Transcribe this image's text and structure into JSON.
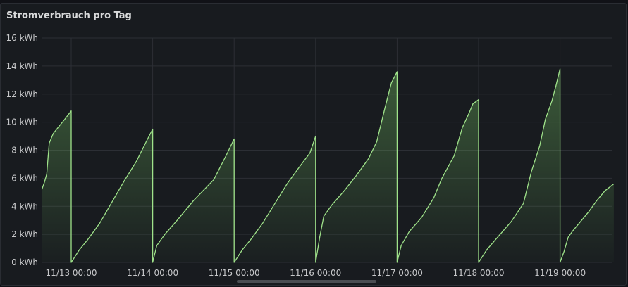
{
  "panel": {
    "title": "Stromverbrauch pro Tag"
  },
  "colors": {
    "line": "#9fe28a",
    "fill_top": "#7ed36a",
    "background": "#181b1f",
    "grid": "#2c2f35",
    "text": "#c7c8ca"
  },
  "chart_data": {
    "type": "area",
    "title": "Stromverbrauch pro Tag",
    "xlabel": "",
    "ylabel": "",
    "unit": "kWh",
    "ylim": [
      0,
      16
    ],
    "y_ticks": [
      "0 kWh",
      "2 kWh",
      "4 kWh",
      "6 kWh",
      "8 kWh",
      "10 kWh",
      "12 kWh",
      "14 kWh",
      "16 kWh"
    ],
    "x_tick_labels": [
      "11/13 00:00",
      "11/14 00:00",
      "11/15 00:00",
      "11/16 00:00",
      "11/17 00:00",
      "11/18 00:00",
      "11/19 00:00"
    ],
    "x_range_days": [
      -0.36,
      6.66
    ],
    "grid": true,
    "legend": "none",
    "series": [
      {
        "values_by_day": [
          [
            [
              -0.36,
              5.2
            ],
            [
              -0.33,
              5.7
            ],
            [
              -0.3,
              6.3
            ],
            [
              -0.27,
              8.5
            ],
            [
              -0.22,
              9.2
            ],
            [
              -0.15,
              9.7
            ],
            [
              -0.08,
              10.2
            ],
            [
              0.0,
              10.8
            ]
          ],
          [
            [
              0.0,
              0.0
            ],
            [
              0.1,
              0.9
            ],
            [
              0.2,
              1.6
            ],
            [
              0.35,
              2.8
            ],
            [
              0.5,
              4.3
            ],
            [
              0.65,
              5.8
            ],
            [
              0.8,
              7.2
            ],
            [
              0.92,
              8.6
            ],
            [
              1.0,
              9.5
            ]
          ],
          [
            [
              1.0,
              0.0
            ],
            [
              1.05,
              1.2
            ],
            [
              1.15,
              2.0
            ],
            [
              1.3,
              3.0
            ],
            [
              1.5,
              4.4
            ],
            [
              1.6,
              5.0
            ],
            [
              1.75,
              5.9
            ],
            [
              1.9,
              7.6
            ],
            [
              2.0,
              8.8
            ]
          ],
          [
            [
              2.0,
              0.0
            ],
            [
              2.1,
              0.9
            ],
            [
              2.2,
              1.6
            ],
            [
              2.35,
              2.8
            ],
            [
              2.5,
              4.2
            ],
            [
              2.65,
              5.6
            ],
            [
              2.8,
              6.8
            ],
            [
              2.93,
              7.8
            ],
            [
              3.0,
              9.0
            ]
          ],
          [
            [
              3.0,
              0.0
            ],
            [
              3.05,
              1.8
            ],
            [
              3.1,
              3.3
            ],
            [
              3.2,
              4.1
            ],
            [
              3.35,
              5.1
            ],
            [
              3.5,
              6.2
            ],
            [
              3.65,
              7.4
            ],
            [
              3.75,
              8.6
            ],
            [
              3.85,
              11.0
            ],
            [
              3.93,
              12.8
            ],
            [
              4.0,
              13.6
            ]
          ],
          [
            [
              4.0,
              0.0
            ],
            [
              4.05,
              1.2
            ],
            [
              4.15,
              2.2
            ],
            [
              4.3,
              3.2
            ],
            [
              4.45,
              4.6
            ],
            [
              4.55,
              6.0
            ],
            [
              4.7,
              7.6
            ],
            [
              4.8,
              9.6
            ],
            [
              4.88,
              10.6
            ],
            [
              4.93,
              11.3
            ],
            [
              5.0,
              11.6
            ]
          ],
          [
            [
              5.0,
              0.0
            ],
            [
              5.1,
              0.9
            ],
            [
              5.25,
              1.9
            ],
            [
              5.4,
              2.9
            ],
            [
              5.55,
              4.2
            ],
            [
              5.65,
              6.5
            ],
            [
              5.75,
              8.3
            ],
            [
              5.82,
              10.2
            ],
            [
              5.9,
              11.5
            ],
            [
              5.95,
              12.6
            ],
            [
              6.0,
              13.8
            ]
          ],
          [
            [
              6.0,
              0.0
            ],
            [
              6.05,
              0.8
            ],
            [
              6.1,
              1.8
            ],
            [
              6.15,
              2.2
            ],
            [
              6.25,
              2.9
            ],
            [
              6.35,
              3.6
            ],
            [
              6.45,
              4.4
            ],
            [
              6.55,
              5.1
            ],
            [
              6.66,
              5.6
            ]
          ]
        ]
      }
    ]
  }
}
